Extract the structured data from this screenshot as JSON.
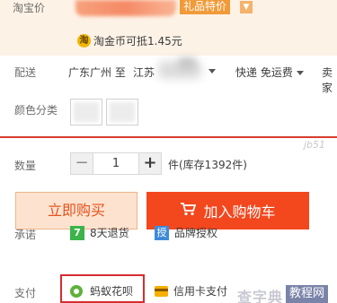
{
  "price": {
    "label": "淘宝价",
    "gift_badge": "礼品特价",
    "gift_caret": "▼",
    "coin_icon": "淘",
    "coin_text": "淘金币可抵1.45元"
  },
  "shipping": {
    "label": "配送",
    "from": "广东广州 至",
    "to": "江苏",
    "express": "快递 免运费",
    "more": "卖家"
  },
  "color": {
    "label": "颜色分类"
  },
  "quantity": {
    "label": "数量",
    "minus": "−",
    "value": "1",
    "plus": "+",
    "stock": "件(库存1392件)"
  },
  "actions": {
    "buy_now": "立即购买",
    "add_to_cart": "加入购物车"
  },
  "promise": {
    "label": "承诺",
    "return_icon": "7",
    "return_text": "8天退货",
    "brand_icon": "授",
    "brand_text": "品牌授权"
  },
  "payment": {
    "label": "支付",
    "huabei": "蚂蚁花呗",
    "credit_card": "信用卡支付"
  },
  "watermark": {
    "top": "jb51",
    "site": "查字典",
    "tag": "教程网"
  },
  "colors": {
    "accent": "#f3471e",
    "buy_now_bg": "#fde3cf",
    "price_bg": "#fdf2e6",
    "highlight": "#d62d2d"
  }
}
